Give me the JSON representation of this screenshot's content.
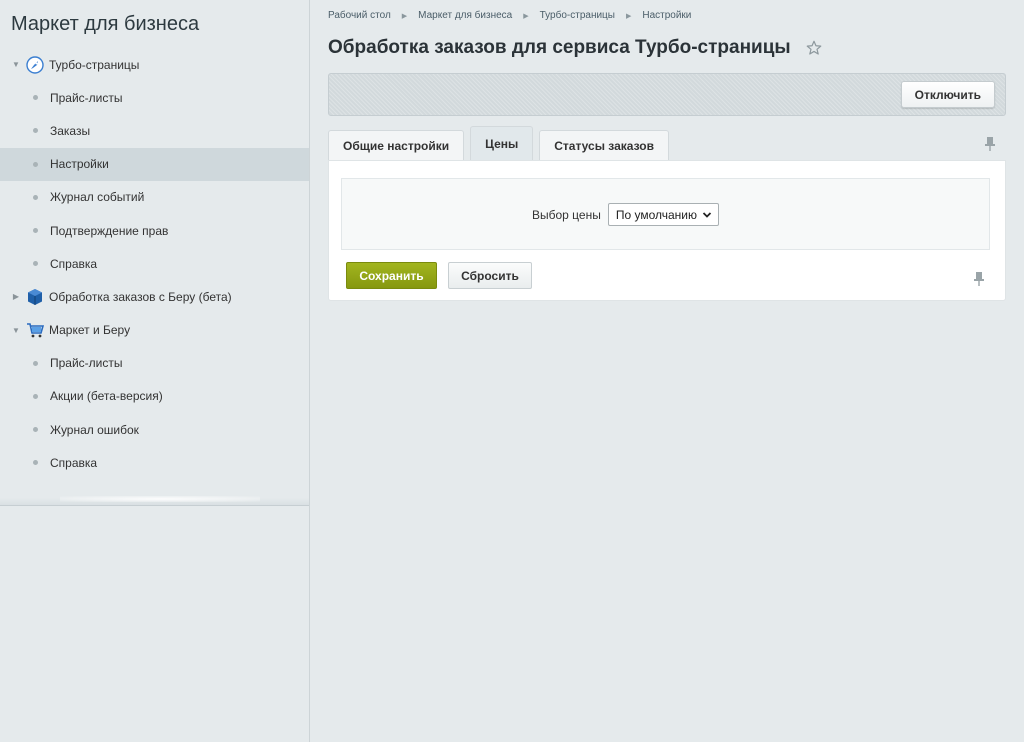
{
  "sidebar": {
    "title": "Маркет для бизнеса",
    "groups": [
      {
        "label": "Турбо-страницы",
        "expanded": true,
        "icon": "rocket-icon",
        "items": [
          "Прайс-листы",
          "Заказы",
          "Настройки",
          "Журнал событий",
          "Подтверждение прав",
          "Справка"
        ]
      },
      {
        "label": "Обработка заказов с Беру (бета)",
        "expanded": false,
        "icon": "box-icon",
        "items": []
      },
      {
        "label": "Маркет и Беру",
        "expanded": true,
        "icon": "cart-icon",
        "items": [
          "Прайс-листы",
          "Акции (бета-версия)",
          "Журнал ошибок",
          "Справка"
        ]
      }
    ],
    "active_item": "Настройки"
  },
  "breadcrumb": [
    "Рабочий стол",
    "Маркет для бизнеса",
    "Турбо-страницы",
    "Настройки"
  ],
  "page": {
    "title": "Обработка заказов для сервиса Турбо-страницы"
  },
  "toolbar": {
    "disable_label": "Отключить"
  },
  "tabs": [
    "Общие настройки",
    "Цены",
    "Статусы заказов"
  ],
  "active_tab": "Цены",
  "form": {
    "price_label": "Выбор цены",
    "price_value": "По умолчанию"
  },
  "buttons": {
    "save": "Сохранить",
    "reset": "Сбросить"
  },
  "colors": {
    "accent_green": "#8fa316",
    "active_row": "#cfd8dc",
    "background": "#e5eaec"
  }
}
